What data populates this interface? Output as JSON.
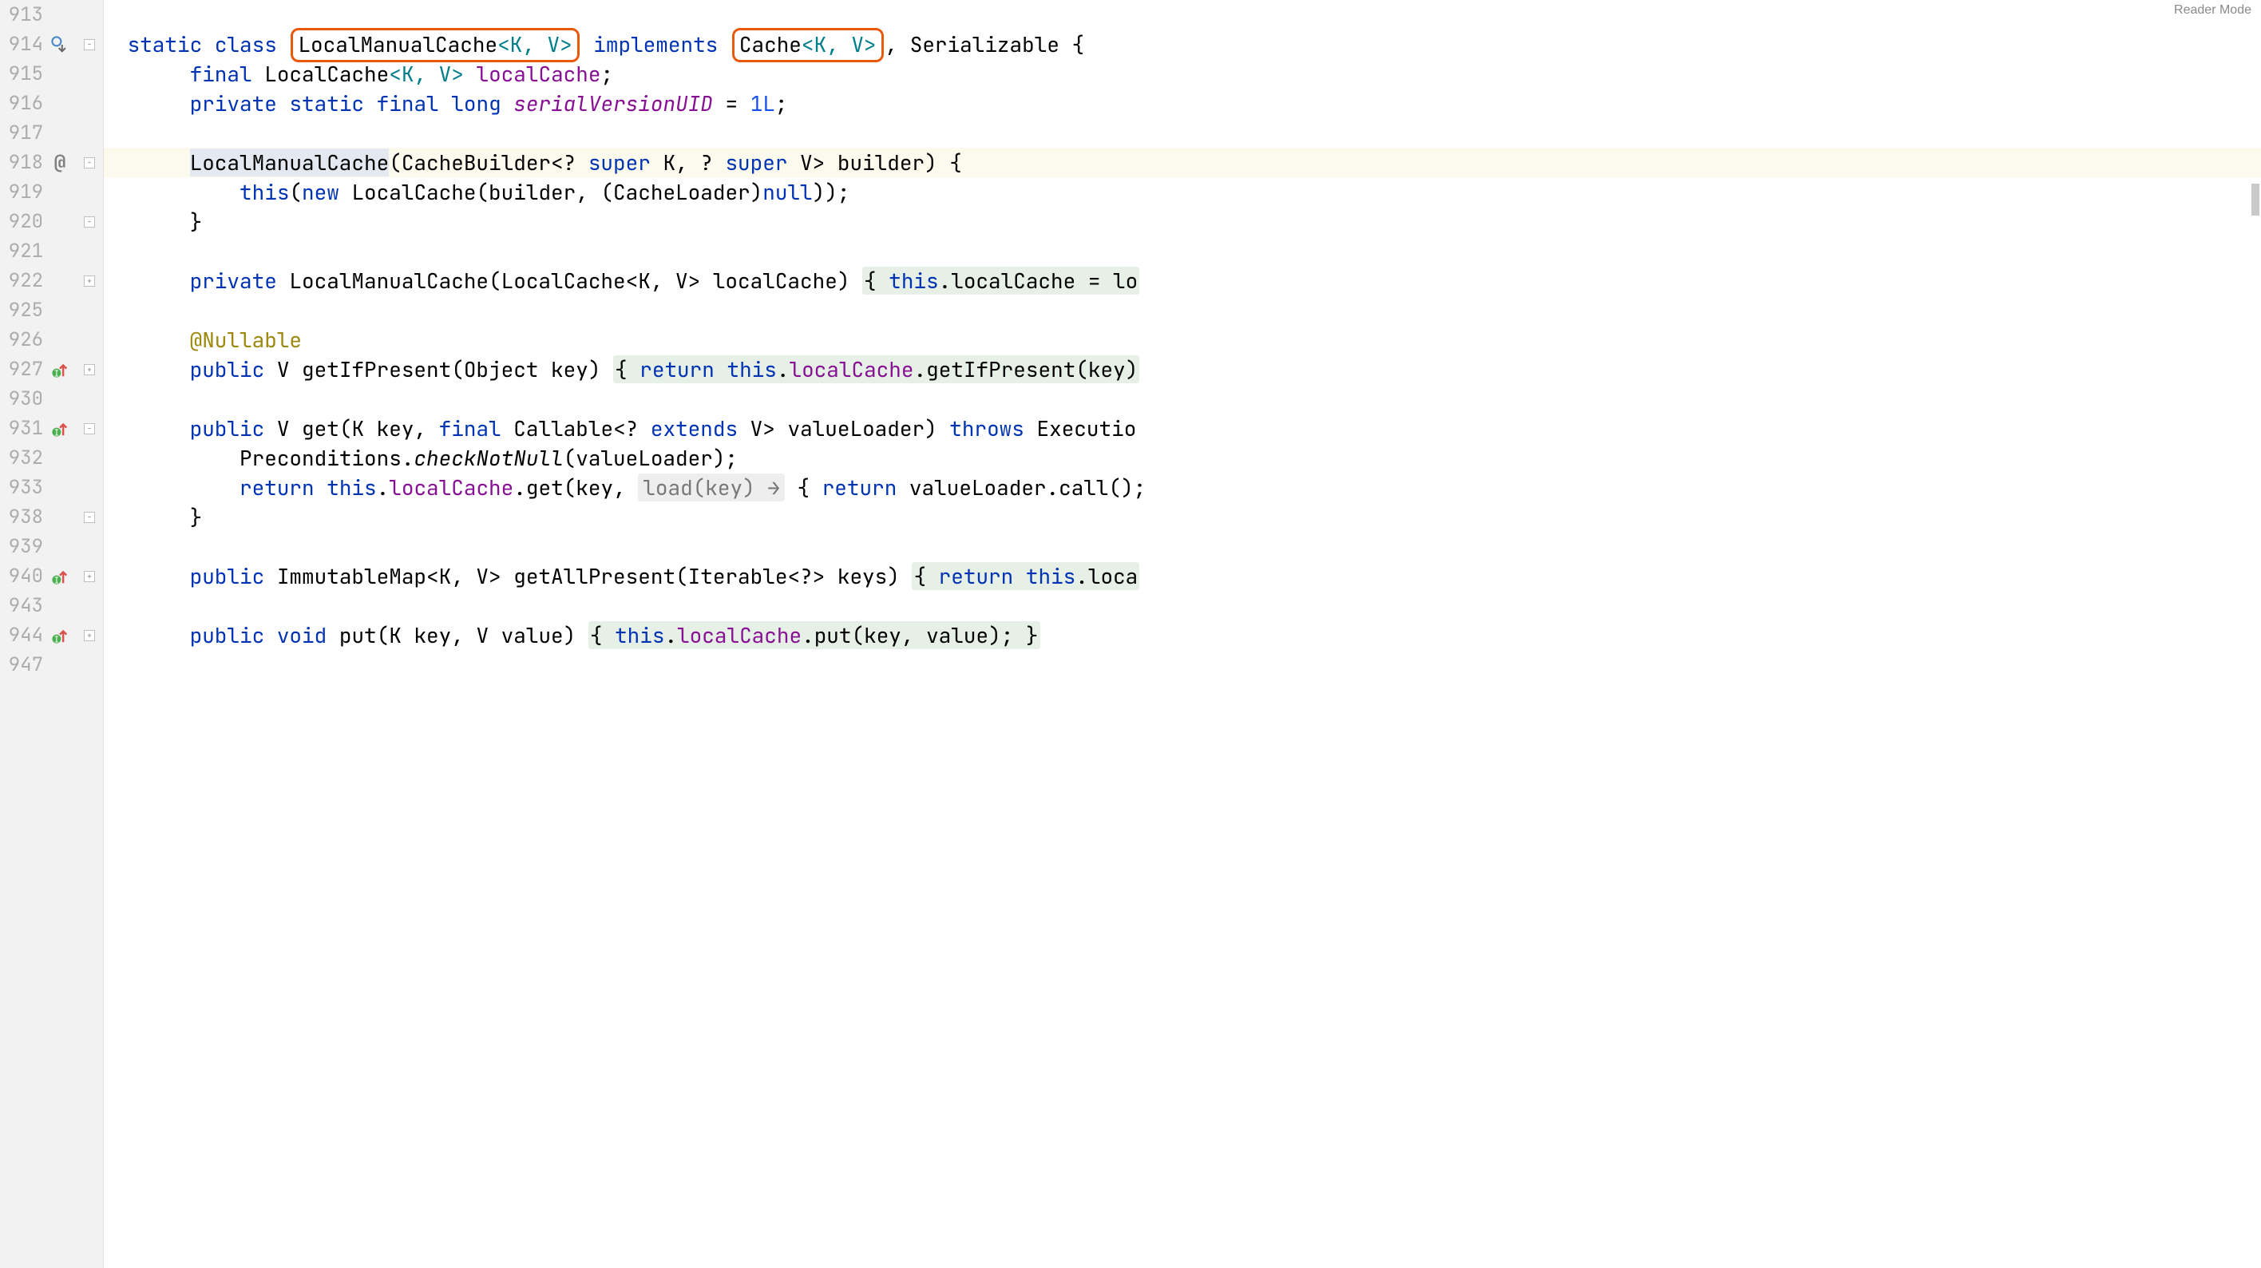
{
  "reader_mode_label": "Reader Mode",
  "gutter": {
    "lines": [
      "913",
      "914",
      "915",
      "916",
      "917",
      "918",
      "919",
      "920",
      "921",
      "922",
      "925",
      "926",
      "927",
      "930",
      "931",
      "932",
      "933",
      "938",
      "939",
      "940",
      "943",
      "944",
      "947"
    ]
  },
  "tokens": {
    "kw_static": "static",
    "kw_class": "class",
    "kw_implements": "implements",
    "kw_final": "final",
    "kw_private": "private",
    "kw_public": "public",
    "kw_long": "long",
    "kw_this": "this",
    "kw_new": "new",
    "kw_null": "null",
    "kw_return": "return",
    "kw_super": "super",
    "kw_extends": "extends",
    "kw_throws": "throws",
    "kw_void": "void"
  },
  "code": {
    "l914": {
      "class_name": "LocalManualCache",
      "generics1": "<K, V>",
      "iface": "Cache",
      "generics2": "<K, V>",
      "serializable": "Serializable",
      "brace": " {"
    },
    "l915": {
      "type": "LocalCache",
      "gen": "<K, V>",
      "field": "localCache",
      "semi": ";"
    },
    "l916": {
      "field": "serialVersionUID",
      "eq": " = ",
      "val": "1L",
      "semi": ";"
    },
    "l918": {
      "name": "LocalManualCache",
      "sig1": "(CacheBuilder<? ",
      "sig2": " K, ? ",
      "sig3": " V> builder) {"
    },
    "l919": {
      "this_open": "(",
      "localcache": " LocalCache(builder, (CacheLoader)",
      "close": "));"
    },
    "l920": {
      "brace": "}"
    },
    "l922": {
      "sig": " LocalManualCache(LocalCache<K, V> localCache) ",
      "body": "{ ",
      "assign": ".localCache = lo"
    },
    "l926": {
      "ann": "@Nullable"
    },
    "l927": {
      "ret": " V ",
      "name": "getIfPresent",
      "params": "(Object key) ",
      "body_open": "{ ",
      "ret_kw_sp": " ",
      "this_dot": ".",
      "field": "localCache",
      "call": ".getIfPresent(key)"
    },
    "l931": {
      "ret": " V ",
      "name": "get",
      "p1": "(K key, ",
      "callable": " Callable<? ",
      "p2": " V> valueLoader) ",
      "exc": " Executio"
    },
    "l932": {
      "pre": "Preconditions.",
      "check": "checkNotNull",
      "arg": "(valueLoader);"
    },
    "l933": {
      "this_dot": " ",
      "field": "localCache",
      "get": ".get(key, ",
      "hint": "load(key) →",
      "body": " { ",
      "call": " valueLoader.call();"
    },
    "l938": {
      "brace": "}"
    },
    "l940": {
      "ret": " ImmutableMap<K, V> ",
      "name": "getAllPresent",
      "params": "(Iterable<?> keys) ",
      "body": "{ ",
      "tail": ".loca"
    },
    "l944": {
      "ret": " ",
      "name": "put",
      "params": "(K key, V value) ",
      "body": "{ ",
      "field": "localCache",
      "call": ".put(key, value); ",
      "close": "}"
    }
  }
}
